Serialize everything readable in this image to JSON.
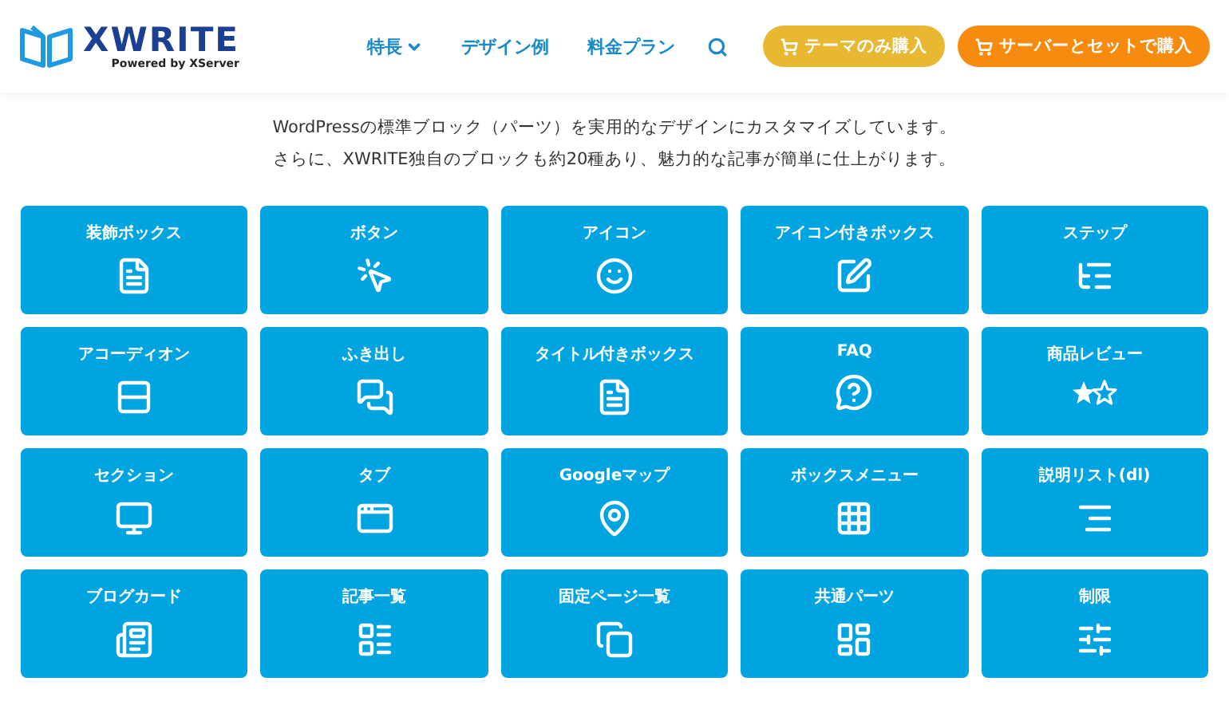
{
  "header": {
    "logo": "XWRITE",
    "tagline": "Powered by XServer",
    "nav": [
      {
        "label": "特長",
        "has_menu": true
      },
      {
        "label": "デザイン例",
        "has_menu": false
      },
      {
        "label": "料金プラン",
        "has_menu": false
      }
    ],
    "buttons": [
      {
        "label": "テーマのみ購入",
        "color": "#e8b832"
      },
      {
        "label": "サーバーとセットで購入",
        "color": "#f78b10"
      }
    ]
  },
  "intro": [
    "WordPressの標準ブロック（パーツ）を実用的なデザインにカスタマイズしています。",
    "さらに、XWRITE独自のブロックも約20種あり、魅力的な記事が簡単に仕上がります。"
  ],
  "blocks": [
    {
      "label": "装飾ボックス"
    },
    {
      "label": "ボタン"
    },
    {
      "label": "アイコン"
    },
    {
      "label": "アイコン付きボックス"
    },
    {
      "label": "ステップ"
    },
    {
      "label": "アコーディオン"
    },
    {
      "label": "ふき出し"
    },
    {
      "label": "タイトル付きボックス"
    },
    {
      "label": "FAQ"
    },
    {
      "label": "商品レビュー"
    },
    {
      "label": "セクション"
    },
    {
      "label": "タブ"
    },
    {
      "label": "Googleマップ"
    },
    {
      "label": "ボックスメニュー"
    },
    {
      "label": "説明リスト(dl)"
    },
    {
      "label": "ブログカード"
    },
    {
      "label": "記事一覧"
    },
    {
      "label": "固定ページ一覧"
    },
    {
      "label": "共通パーツ"
    },
    {
      "label": "制限"
    }
  ]
}
